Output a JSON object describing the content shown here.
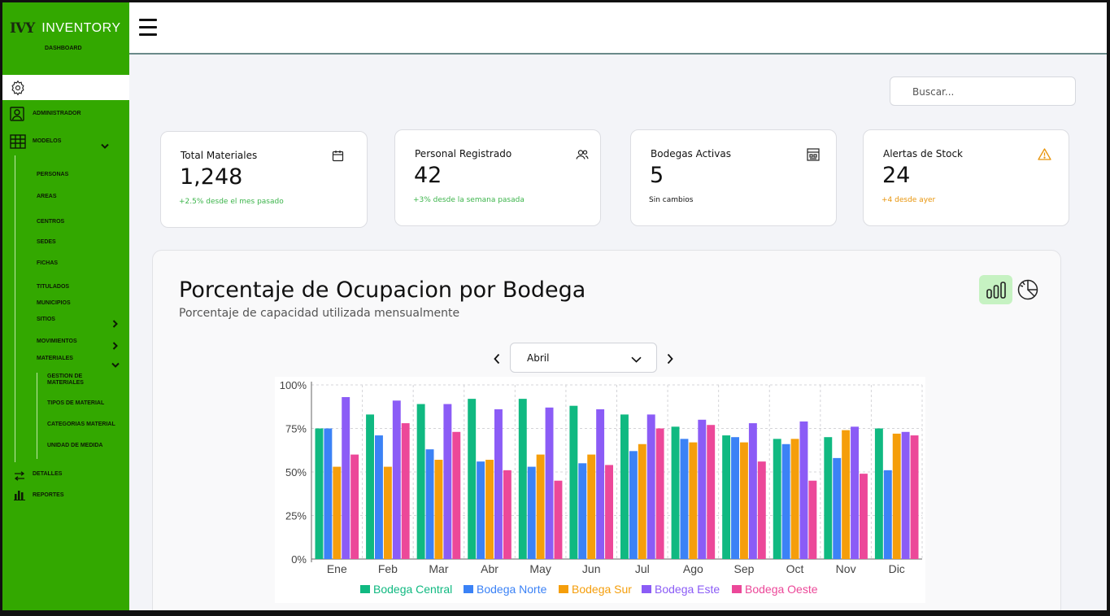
{
  "sidebar": {
    "brand_logo": "IVY",
    "brand_title": "INVENTORY",
    "brand_sub": "DASHBOARD",
    "items": {
      "administrador": "ADMINISTRADOR",
      "modelos": "MODELOS",
      "personas": "PERSONAS",
      "areas": "AREAS",
      "centros": "CENTROS",
      "sedes": "SEDES",
      "fichas": "FICHAS",
      "titulados": "TITULADOS",
      "municipios": "MUNICIPIOS",
      "sitios": "SITIOS",
      "movimientos": "MOVIMIENTOS",
      "materiales": "MATERIALES",
      "gestion1": "GESTION DE",
      "gestion2": "MATERIALES",
      "tipos": "TIPOS DE MATERIAL",
      "categorias": "CATEGORIAS MATERIAL",
      "unidad": "UNIDAD DE MEDIDA",
      "detalles": "DETALLES",
      "reportes": "REPORTES"
    }
  },
  "search": {
    "placeholder": "Buscar..."
  },
  "cards": [
    {
      "title": "Total Materiales",
      "value": "1,248",
      "sub": "+2.5% desde el mes pasado",
      "sub_color": "#3cb44b",
      "icon": "calendar-icon"
    },
    {
      "title": "Personal Registrado",
      "value": "42",
      "sub": "+3% desde la semana pasada",
      "sub_color": "#3cb44b",
      "icon": "users-icon"
    },
    {
      "title": "Bodegas Activas",
      "value": "5",
      "sub": "Sin cambios",
      "sub_color": "#111111",
      "icon": "warehouse-icon"
    },
    {
      "title": "Alertas de Stock",
      "value": "24",
      "sub": "+4 desde ayer",
      "sub_color": "#e8940a",
      "icon": "warning-icon"
    }
  ],
  "panel": {
    "title": "Porcentaje de Ocupacion por Bodega",
    "subtitle": "Porcentaje de capacidad utilizada mensualmente",
    "selected_month": "Abril"
  },
  "chart_data": {
    "type": "bar",
    "categories": [
      "Ene",
      "Feb",
      "Mar",
      "Abr",
      "May",
      "Jun",
      "Jul",
      "Ago",
      "Sep",
      "Oct",
      "Nov",
      "Dic"
    ],
    "ylim": [
      0,
      100
    ],
    "yticks": [
      "0%",
      "25%",
      "50%",
      "75%",
      "100%"
    ],
    "grid": true,
    "legend": "bottom",
    "series": [
      {
        "name": "Bodega Central",
        "color": "#10b981",
        "values": [
          75,
          83,
          89,
          92,
          92,
          88,
          83,
          76,
          71,
          69,
          70,
          75
        ]
      },
      {
        "name": "Bodega Norte",
        "color": "#3b82f6",
        "values": [
          75,
          71,
          63,
          56,
          53,
          55,
          62,
          69,
          70,
          66,
          58,
          51
        ]
      },
      {
        "name": "Bodega Sur",
        "color": "#f59e0b",
        "values": [
          53,
          53,
          57,
          57,
          60,
          60,
          66,
          67,
          67,
          69,
          74,
          72
        ]
      },
      {
        "name": "Bodega Este",
        "color": "#8b5cf6",
        "values": [
          93,
          91,
          89,
          86,
          87,
          86,
          83,
          80,
          78,
          79,
          76,
          73
        ]
      },
      {
        "name": "Bodega Oeste",
        "color": "#ec4899",
        "values": [
          60,
          78,
          73,
          51,
          45,
          54,
          75,
          77,
          56,
          45,
          49,
          71
        ]
      }
    ]
  }
}
